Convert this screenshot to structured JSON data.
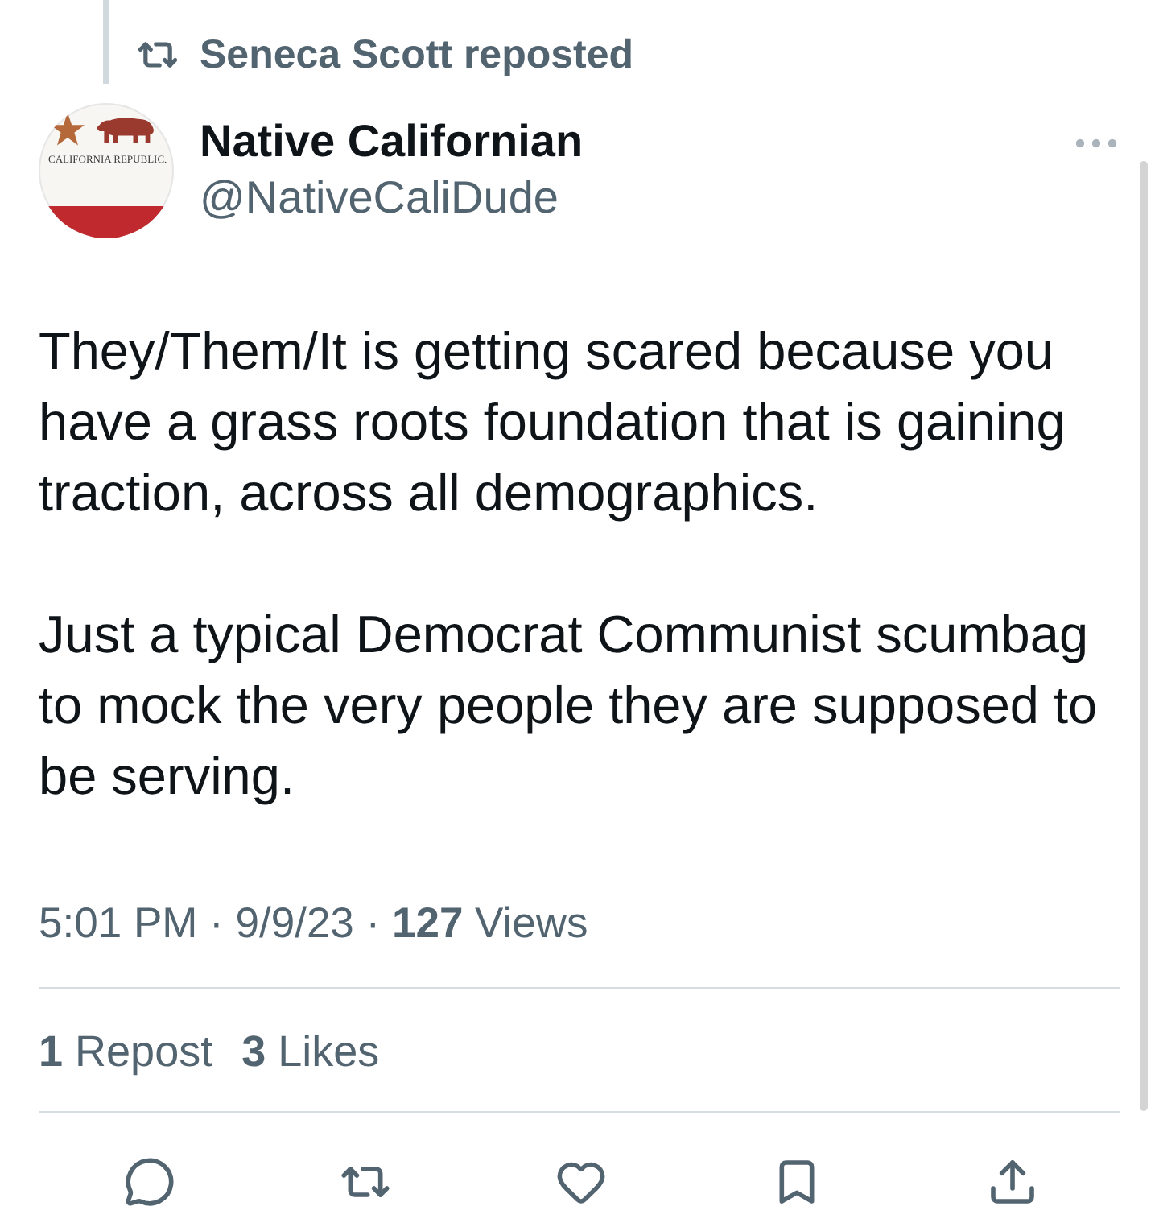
{
  "repost_banner": {
    "text": "Seneca Scott reposted"
  },
  "author": {
    "name": "Native Californian",
    "handle": "@NativeCaliDude",
    "avatar": {
      "caption": "CALIFORNIA REPUBLIC."
    }
  },
  "body": {
    "paragraphs": [
      [
        "They/Them/It is getting scared because you",
        "have a grass roots foundation that is gaining",
        "traction, across all demographics."
      ],
      [
        "Just a typical Democrat Communist scumbag",
        "to mock the very people they are supposed to",
        "be serving."
      ]
    ]
  },
  "meta": "5:01 PM · 9/9/23 · **127** Views",
  "stats": [
    "**1** Repost",
    "**3** Likes"
  ]
}
